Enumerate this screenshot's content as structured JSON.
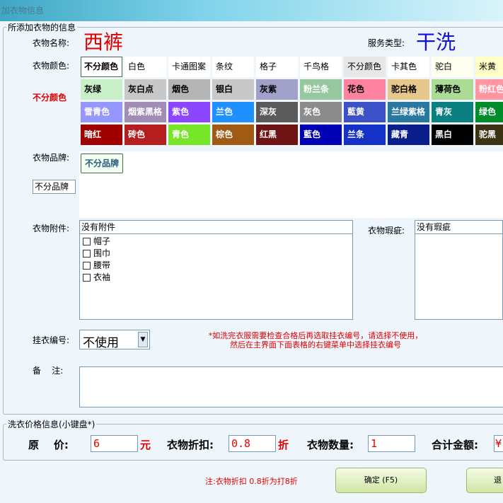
{
  "window": {
    "title": "加衣物信息"
  },
  "clothes_group": {
    "title": "所添加衣物的信息",
    "name_label": "衣物名称:",
    "name_value": "西裤",
    "service_label": "服务类型:",
    "service_value": "干洗",
    "color_label": "衣物颜色:",
    "selected_color": "不分颜色",
    "colors": [
      [
        {
          "label": "不分颜色",
          "bg": "#ffffff",
          "fg": "#000000"
        },
        {
          "label": "白色",
          "bg": "#ffffff",
          "fg": "#000000"
        },
        {
          "label": "卡通图案",
          "bg": "#ffffff",
          "fg": "#000000"
        },
        {
          "label": "条纹",
          "bg": "#ffffff",
          "fg": "#000000"
        },
        {
          "label": "格子",
          "bg": "#ffffff",
          "fg": "#000000"
        },
        {
          "label": "千鸟格",
          "bg": "#ffffff",
          "fg": "#000000"
        },
        {
          "label": "不分颜色",
          "bg": "#e8e8e8",
          "fg": "#000000"
        },
        {
          "label": "卡其色",
          "bg": "#ffffff",
          "fg": "#000000"
        },
        {
          "label": "驼白",
          "bg": "#fffff0",
          "fg": "#000000"
        },
        {
          "label": "米黄",
          "bg": "#ffffc8",
          "fg": "#000000"
        }
      ],
      [
        {
          "label": "灰绿",
          "bg": "#c8f0c8",
          "fg": "#000000"
        },
        {
          "label": "灰白点",
          "bg": "#c8c8c8",
          "fg": "#000000"
        },
        {
          "label": "烟色",
          "bg": "#b4b4b4",
          "fg": "#000000"
        },
        {
          "label": "银白",
          "bg": "#c8c8c8",
          "fg": "#000000"
        },
        {
          "label": "灰紫",
          "bg": "#a0a0c8",
          "fg": "#000000"
        },
        {
          "label": "粉兰条",
          "bg": "#96c8a0",
          "fg": "#ffffff"
        },
        {
          "label": "花色",
          "bg": "#ff82a0",
          "fg": "#000000"
        },
        {
          "label": "驼白格",
          "bg": "#e6c88c",
          "fg": "#000000"
        },
        {
          "label": "薄荷色",
          "bg": "#aadc96",
          "fg": "#000000"
        },
        {
          "label": "粉红色",
          "bg": "#ff96a0",
          "fg": "#ffffff"
        }
      ],
      [
        {
          "label": "雪青色",
          "bg": "#9696ff",
          "fg": "#ffffff"
        },
        {
          "label": "烟紫黑格",
          "bg": "#a08cb4",
          "fg": "#ffffff"
        },
        {
          "label": "紫色",
          "bg": "#8c46ff",
          "fg": "#ffffff"
        },
        {
          "label": "兰色",
          "bg": "#1e90ff",
          "fg": "#ffffff"
        },
        {
          "label": "深灰",
          "bg": "#5a5a5a",
          "fg": "#ffffff"
        },
        {
          "label": "灰色",
          "bg": "#8c8c8c",
          "fg": "#ffffff"
        },
        {
          "label": "藍黄",
          "bg": "#3c50c8",
          "fg": "#ffffff"
        },
        {
          "label": "兰绿紫格",
          "bg": "#2878a0",
          "fg": "#ffffff"
        },
        {
          "label": "青灰",
          "bg": "#0a8080",
          "fg": "#ffffff"
        },
        {
          "label": "绿色",
          "bg": "#008c28",
          "fg": "#ffffff"
        }
      ],
      [
        {
          "label": "暗红",
          "bg": "#a00000",
          "fg": "#ffffff"
        },
        {
          "label": "砖色",
          "bg": "#b41e1e",
          "fg": "#ffffff"
        },
        {
          "label": "青色",
          "bg": "#78e628",
          "fg": "#ffffff"
        },
        {
          "label": "棕色",
          "bg": "#a05a14",
          "fg": "#ffffff"
        },
        {
          "label": "红黑",
          "bg": "#6e1414",
          "fg": "#ffffff"
        },
        {
          "label": "藍色",
          "bg": "#0000b4",
          "fg": "#ffffff"
        },
        {
          "label": "兰条",
          "bg": "#1432c8",
          "fg": "#ffffff"
        },
        {
          "label": "藏青",
          "bg": "#0a1e8c",
          "fg": "#ffffff"
        },
        {
          "label": "黑白",
          "bg": "#000000",
          "fg": "#ffffff"
        },
        {
          "label": "驼黑",
          "bg": "#3c3214",
          "fg": "#ffffff"
        }
      ]
    ],
    "brand_label": "衣物品牌:",
    "brand_button": "不分品牌",
    "brand_value": "不分品牌",
    "accessory_label": "衣物附件:",
    "accessory_value": "没有附件",
    "accessories": [
      "帽子",
      "围巾",
      "腰带",
      "衣袖"
    ],
    "defect_label": "衣物瑕疵:",
    "defect_value": "没有瑕疵",
    "hanger_label": "挂衣编号:",
    "hanger_value": "不使用",
    "hanger_note": "*如洗完衣服需要检查合格后再选取挂衣编号，请选择不使用，然后在主界面下面表格的右键菜单中选择挂衣编号",
    "remark_label": "备    注:",
    "remark_value": ""
  },
  "price_group": {
    "title": "洗衣价格信息(小键盘*)",
    "price_label": "原    价:",
    "price_value": "6",
    "price_unit": "元",
    "discount_label": "衣物折扣:",
    "discount_value": "0.8",
    "discount_unit": "折",
    "qty_label": "衣物数量:",
    "qty_value": "1",
    "total_label": "合计金额:",
    "total_value": "¥"
  },
  "footer": {
    "note": "注:衣物折扣 0.8折为打8折",
    "ok_button": "确定 (F5)",
    "exit_button": "退"
  },
  "colors": {
    "accent_red": "#e00000",
    "service_blue": "#1010e0"
  }
}
